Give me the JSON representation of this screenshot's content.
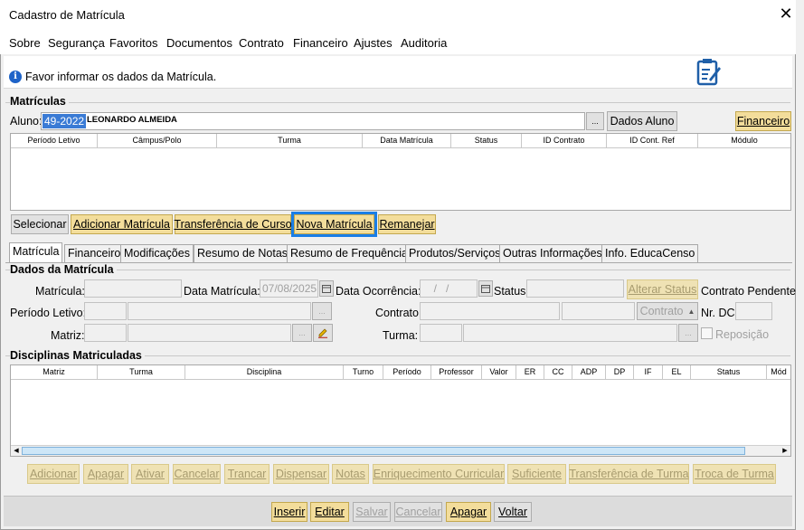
{
  "window": {
    "title": "Cadastro de Matrícula",
    "close": "✕"
  },
  "menu": [
    "Sobre",
    "Segurança",
    "Favoritos",
    "Documentos",
    "Contrato",
    "Financeiro",
    "Ajustes",
    "Auditoria"
  ],
  "info": {
    "message": "Favor informar os dados da Matrícula."
  },
  "matriculas": {
    "group_title": "Matrículas",
    "aluno_label": "Aluno:",
    "aluno_code": "49-2022",
    "aluno_name": "LEONARDO ALMEIDA",
    "browse": "...",
    "dados_aluno": "Dados Aluno",
    "financeiro": "Financeiro",
    "columns": [
      "Período Letivo",
      "Câmpus/Polo",
      "Turma",
      "Data Matrícula",
      "Status",
      "ID Contrato",
      "ID Cont. Ref",
      "Módulo"
    ],
    "buttons": [
      "Selecionar",
      "Adicionar Matrícula",
      "Transferência de Curso",
      "Nova Matrícula",
      "Remanejar"
    ]
  },
  "tabs": [
    "Matrícula",
    "Financeiro",
    "Modificações",
    "Resumo de Notas",
    "Resumo de Frequência",
    "Produtos/Serviços",
    "Outras Informações",
    "Info. EducaCenso"
  ],
  "dados": {
    "group_title": "Dados da Matrícula",
    "matricula_label": "Matrícula:",
    "data_matricula_label": "Data Matrícula:",
    "data_matricula_value": "07/08/2025",
    "data_ocorrencia_label": "Data Ocorrência:",
    "data_ocorrencia_value": "  /   /",
    "status_label": "Status:",
    "alterar_status": "Alterar Status",
    "contrato_pendente": "Contrato Pendente",
    "periodo_label": "Período Letivo:",
    "contrato_label": "Contrato:",
    "contrato_btn": "Contrato",
    "nr_dc_label": "Nr. DC:",
    "matriz_label": "Matriz:",
    "turma_label": "Turma:",
    "reposicao": "Reposição"
  },
  "disciplinas": {
    "group_title": "Disciplinas Matriculadas",
    "columns": [
      "Matriz",
      "Turma",
      "Disciplina",
      "Turno",
      "Período",
      "Professor",
      "Valor",
      "ER",
      "CC",
      "ADP",
      "DP",
      "IF",
      "EL",
      "Status",
      "Mód"
    ],
    "buttons": [
      "Adicionar",
      "Apagar",
      "Ativar",
      "Cancelar",
      "Trancar",
      "Dispensar",
      "Notas",
      "Enriquecimento Curricular",
      "Suficiente",
      "Transferência de Turma",
      "Troca de Turma"
    ]
  },
  "footer": {
    "buttons": [
      "Inserir",
      "Editar",
      "Salvar",
      "Cancelar",
      "Apagar",
      "Voltar"
    ]
  },
  "colors": {
    "accent_button": "#f3dd9b",
    "highlight": "#1a7ee6",
    "selection": "#3a7bd5"
  }
}
